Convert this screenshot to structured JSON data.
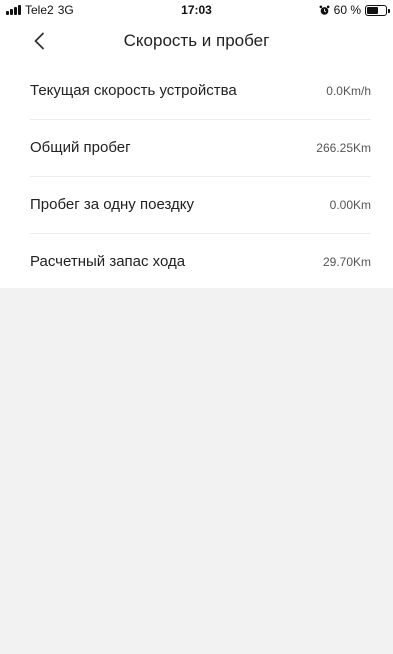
{
  "status_bar": {
    "carrier": "Tele2",
    "network": "3G",
    "time": "17:03",
    "battery_text": "60 %",
    "battery_level": 0.6,
    "icons": [
      "signal-icon",
      "alarm-icon",
      "battery-icon"
    ]
  },
  "header": {
    "title": "Скорость и пробег",
    "back_icon": "chevron-left-icon"
  },
  "rows": [
    {
      "label": "Текущая скорость устройства",
      "value": "0.0Km/h"
    },
    {
      "label": "Общий пробег",
      "value": "266.25Km"
    },
    {
      "label": "Пробег за одну поездку",
      "value": "0.00Km"
    },
    {
      "label": "Расчетный запас хода",
      "value": "29.70Km"
    }
  ],
  "colors": {
    "background": "#f2f2f2",
    "surface": "#ffffff",
    "divider": "#ececec",
    "text": "#222222",
    "value_text": "#555555"
  }
}
